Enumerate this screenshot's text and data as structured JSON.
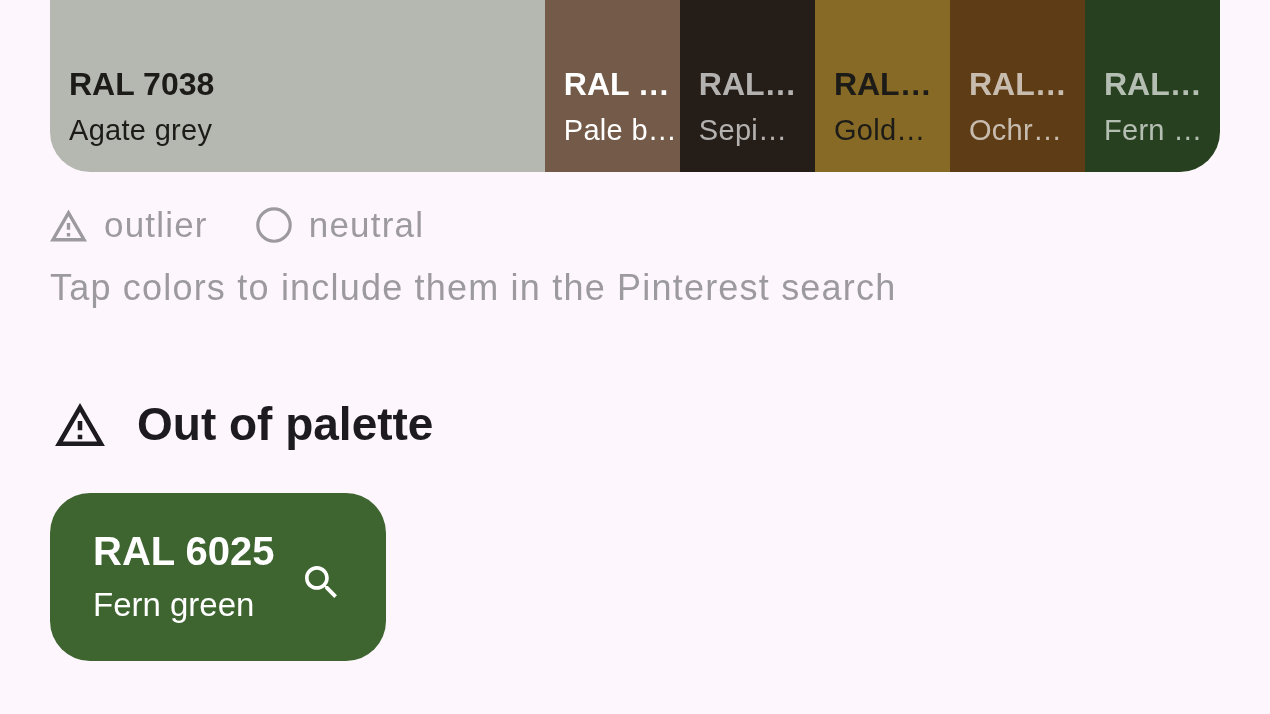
{
  "palette": {
    "swatches": [
      {
        "code": "RAL 7038",
        "name": "Agate grey",
        "color": "#b5b8b0",
        "expanded": true,
        "selected": true
      },
      {
        "code": "RAL …",
        "name": "Pale b…",
        "color": "#745b49",
        "expanded": false,
        "selected": true
      },
      {
        "code": "RAL…",
        "name": "Sepi…",
        "color": "#251d17",
        "expanded": false,
        "selected": false
      },
      {
        "code": "RAL…",
        "name": "Gold…",
        "color": "#866a25",
        "expanded": false,
        "selected": true
      },
      {
        "code": "RAL…",
        "name": "Ochr…",
        "color": "#5e3c15",
        "expanded": false,
        "selected": false
      },
      {
        "code": "RAL…",
        "name": "Fern …",
        "color": "#27401f",
        "expanded": false,
        "selected": false
      }
    ]
  },
  "legend": [
    {
      "kind": "outlier",
      "label": "outlier"
    },
    {
      "kind": "neutral",
      "label": "neutral"
    }
  ],
  "hint": "Tap colors to include them in the Pinterest search",
  "out_of_palette": {
    "title": "Out of palette",
    "colors": [
      {
        "code": "RAL 6025",
        "name": "Fern green",
        "color": "#3e6530"
      }
    ]
  }
}
